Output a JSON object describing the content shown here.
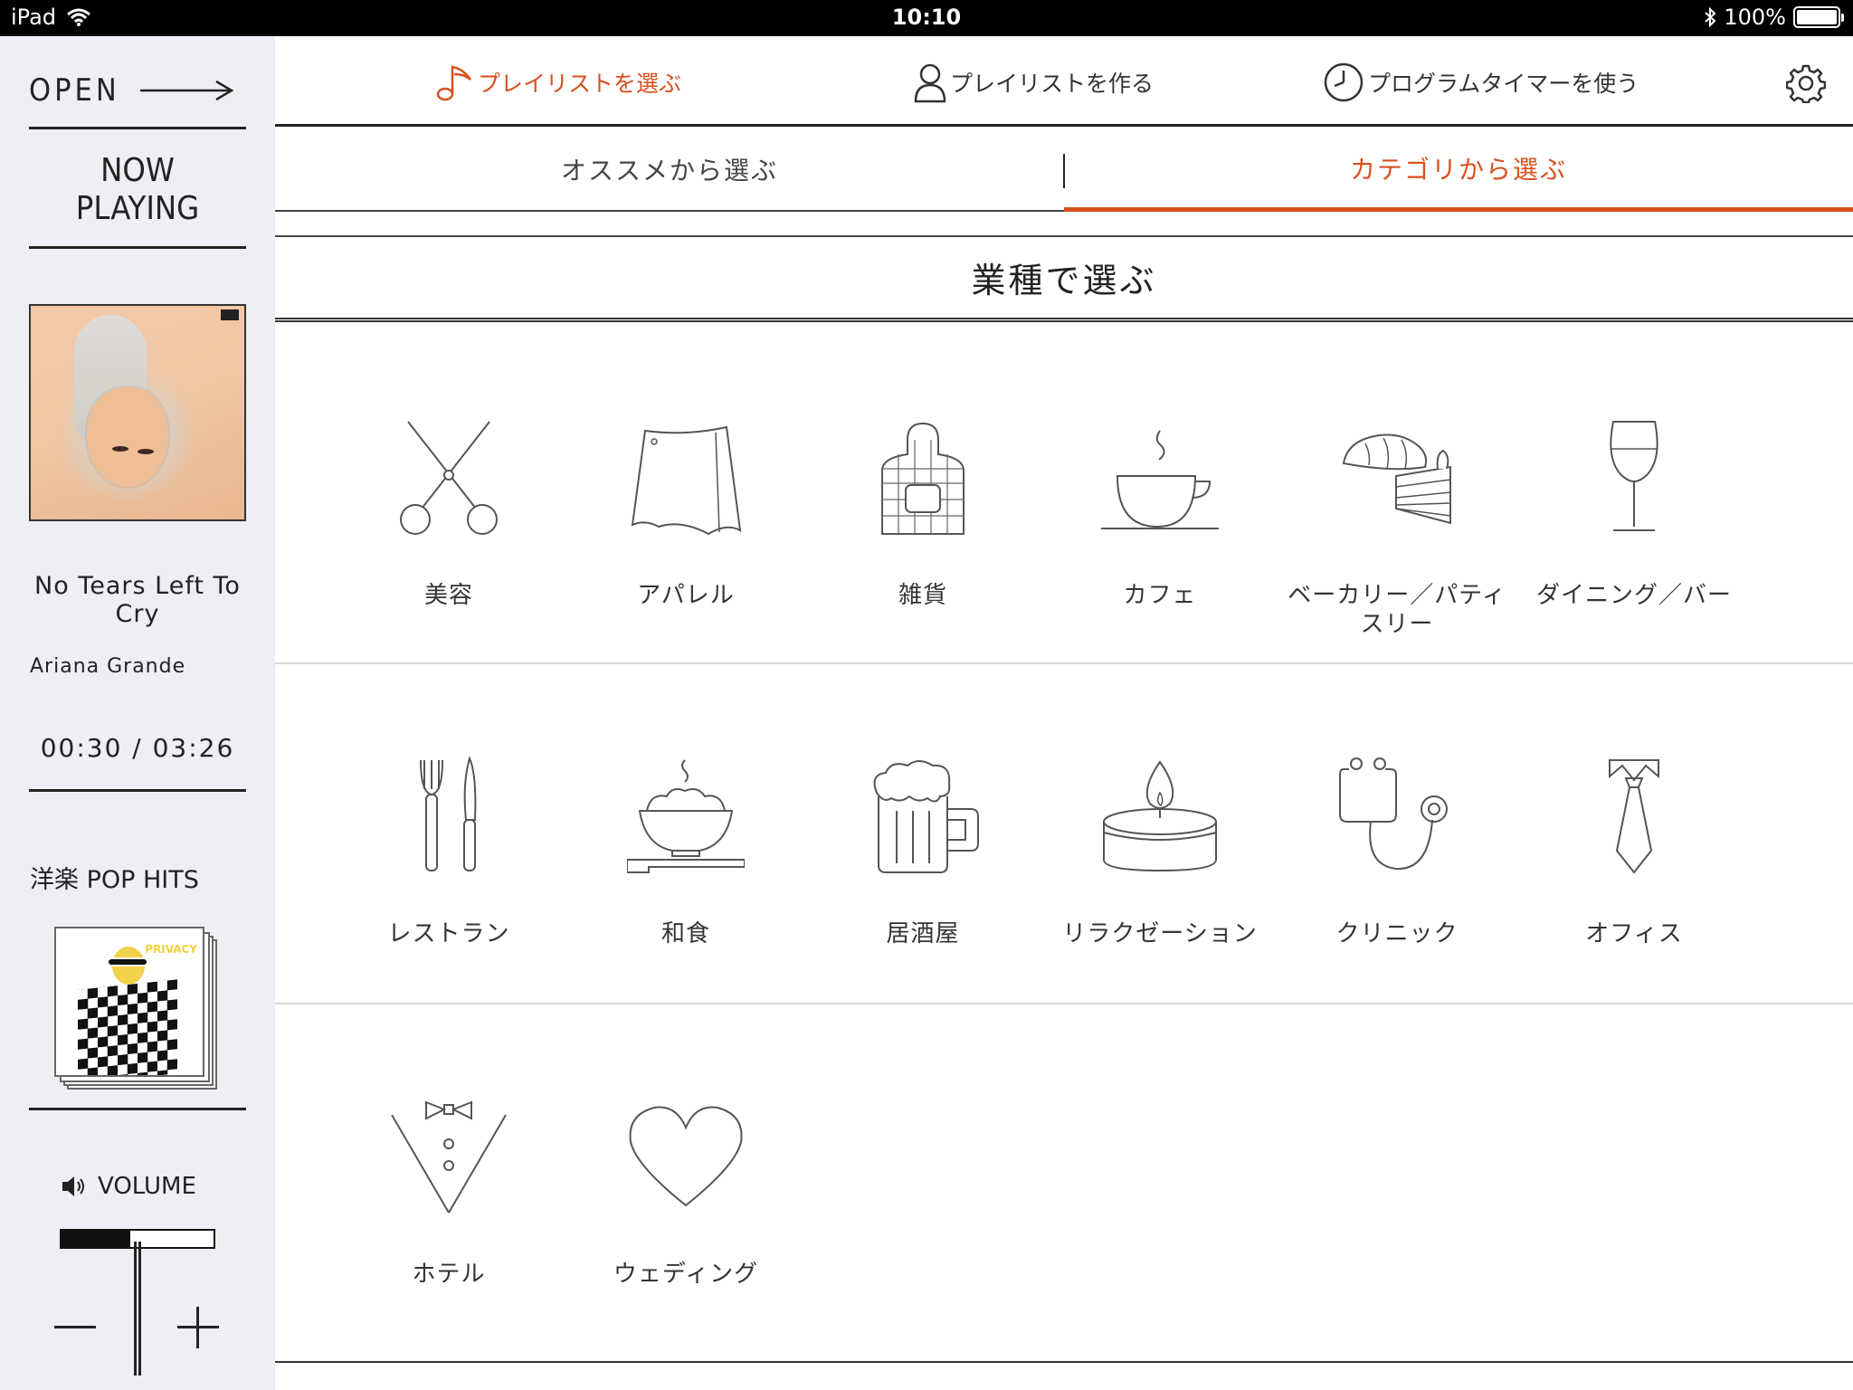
{
  "status_bar": {
    "device": "iPad",
    "time": "10:10",
    "battery": "100%"
  },
  "sidebar": {
    "open_label": "OPEN",
    "now_playing_label": "NOW\nPLAYING",
    "track_title": "No Tears Left To Cry",
    "artist": "Ariana Grande",
    "time": "00:30 / 03:26",
    "playlist_name": "洋楽 POP HITS",
    "volume_label": "VOLUME",
    "volume_level": 0.45
  },
  "topnav": {
    "items": [
      {
        "label": "プレイリストを選ぶ",
        "icon": "music-note-icon",
        "active": true
      },
      {
        "label": "プレイリストを作る",
        "icon": "person-icon",
        "active": false
      },
      {
        "label": "プログラムタイマーを使う",
        "icon": "clock-icon",
        "active": false
      }
    ],
    "settings_icon": "gear-icon"
  },
  "subtabs": [
    {
      "label": "オススメから選ぶ",
      "active": false
    },
    {
      "label": "カテゴリから選ぶ",
      "active": true
    }
  ],
  "section_title": "業種で選ぶ",
  "categories": [
    {
      "label": "美容",
      "icon": "scissors-icon"
    },
    {
      "label": "アパレル",
      "icon": "skirt-icon"
    },
    {
      "label": "雑貨",
      "icon": "apron-icon"
    },
    {
      "label": "カフェ",
      "icon": "coffee-cup-icon"
    },
    {
      "label": "ベーカリー／パティスリー",
      "icon": "bread-cake-icon"
    },
    {
      "label": "ダイニング／バー",
      "icon": "wine-glass-icon"
    },
    {
      "label": "レストラン",
      "icon": "fork-knife-icon"
    },
    {
      "label": "和食",
      "icon": "rice-bowl-icon"
    },
    {
      "label": "居酒屋",
      "icon": "beer-mug-icon"
    },
    {
      "label": "リラクゼーション",
      "icon": "candle-icon"
    },
    {
      "label": "クリニック",
      "icon": "stethoscope-icon"
    },
    {
      "label": "オフィス",
      "icon": "necktie-icon"
    },
    {
      "label": "ホテル",
      "icon": "tuxedo-icon"
    },
    {
      "label": "ウェディング",
      "icon": "heart-icon"
    }
  ],
  "colors": {
    "accent": "#d9501f",
    "sidebar_bg": "#eeeef4",
    "text": "#333333"
  }
}
